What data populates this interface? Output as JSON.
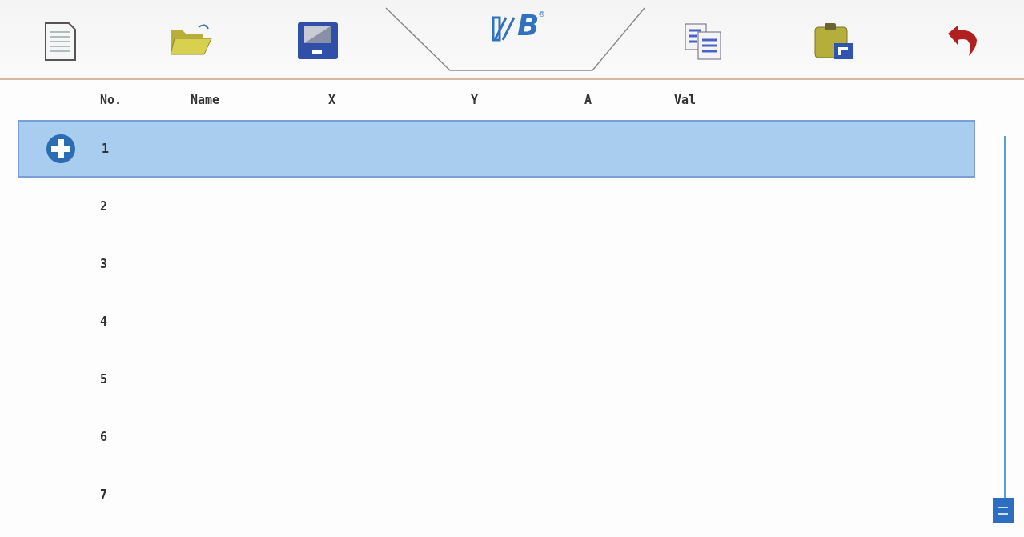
{
  "toolbar": {
    "logo": {
      "text": "B",
      "mark": "®"
    }
  },
  "table": {
    "columns": [
      "No.",
      "Name",
      "X",
      "Y",
      "A",
      "Val"
    ],
    "rows": [
      {
        "no": "1",
        "selected": true
      },
      {
        "no": "2",
        "selected": false
      },
      {
        "no": "3",
        "selected": false
      },
      {
        "no": "4",
        "selected": false
      },
      {
        "no": "5",
        "selected": false
      },
      {
        "no": "6",
        "selected": false
      },
      {
        "no": "7",
        "selected": false
      }
    ]
  }
}
